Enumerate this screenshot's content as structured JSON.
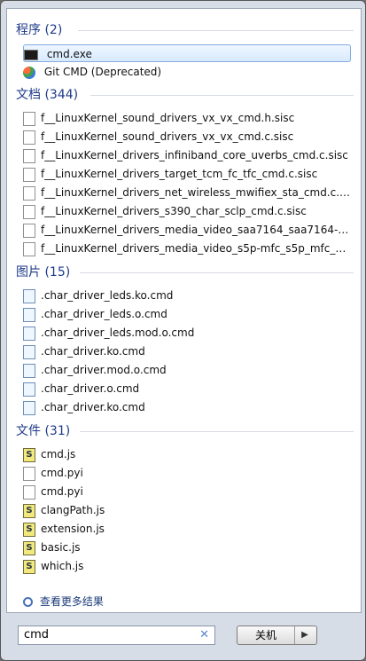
{
  "sections": [
    {
      "title": "程序 (2)",
      "items": [
        {
          "label": "cmd.exe",
          "icon": "cmd-icon",
          "selected": true
        },
        {
          "label": "Git CMD (Deprecated)",
          "icon": "git-icon"
        }
      ]
    },
    {
      "title": "文档 (344)",
      "items": [
        {
          "label": "f__LinuxKernel_sound_drivers_vx_vx_cmd.h.sisc",
          "icon": "doc-icon"
        },
        {
          "label": "f__LinuxKernel_sound_drivers_vx_vx_cmd.c.sisc",
          "icon": "doc-icon"
        },
        {
          "label": "f__LinuxKernel_drivers_infiniband_core_uverbs_cmd.c.sisc",
          "icon": "doc-icon"
        },
        {
          "label": "f__LinuxKernel_drivers_target_tcm_fc_tfc_cmd.c.sisc",
          "icon": "doc-icon"
        },
        {
          "label": "f__LinuxKernel_drivers_net_wireless_mwifiex_sta_cmd.c.sisc",
          "icon": "doc-icon"
        },
        {
          "label": "f__LinuxKernel_drivers_s390_char_sclp_cmd.c.sisc",
          "icon": "doc-icon"
        },
        {
          "label": "f__LinuxKernel_drivers_media_video_saa7164_saa7164-cm...",
          "icon": "doc-icon"
        },
        {
          "label": "f__LinuxKernel_drivers_media_video_s5p-mfc_s5p_mfc_cm...",
          "icon": "doc-icon"
        }
      ]
    },
    {
      "title": "图片 (15)",
      "items": [
        {
          "label": ".char_driver_leds.ko.cmd",
          "icon": "img-icon"
        },
        {
          "label": ".char_driver_leds.o.cmd",
          "icon": "img-icon"
        },
        {
          "label": ".char_driver_leds.mod.o.cmd",
          "icon": "img-icon"
        },
        {
          "label": ".char_driver.ko.cmd",
          "icon": "img-icon"
        },
        {
          "label": ".char_driver.mod.o.cmd",
          "icon": "img-icon"
        },
        {
          "label": ".char_driver.o.cmd",
          "icon": "img-icon"
        },
        {
          "label": ".char_driver.ko.cmd",
          "icon": "img-icon"
        }
      ]
    },
    {
      "title": "文件 (31)",
      "items": [
        {
          "label": "cmd.js",
          "icon": "js-icon"
        },
        {
          "label": "cmd.pyi",
          "icon": "doc-icon"
        },
        {
          "label": "cmd.pyi",
          "icon": "doc-icon"
        },
        {
          "label": "clangPath.js",
          "icon": "js-icon"
        },
        {
          "label": "extension.js",
          "icon": "js-icon"
        },
        {
          "label": "basic.js",
          "icon": "js-icon"
        },
        {
          "label": "which.js",
          "icon": "js-icon"
        }
      ]
    }
  ],
  "see_more": "查看更多结果",
  "search": {
    "value": "cmd"
  },
  "shutdown": {
    "label": "关机"
  },
  "colors": {
    "accent": "#1e3a8a",
    "selection": "#d8eaff"
  }
}
